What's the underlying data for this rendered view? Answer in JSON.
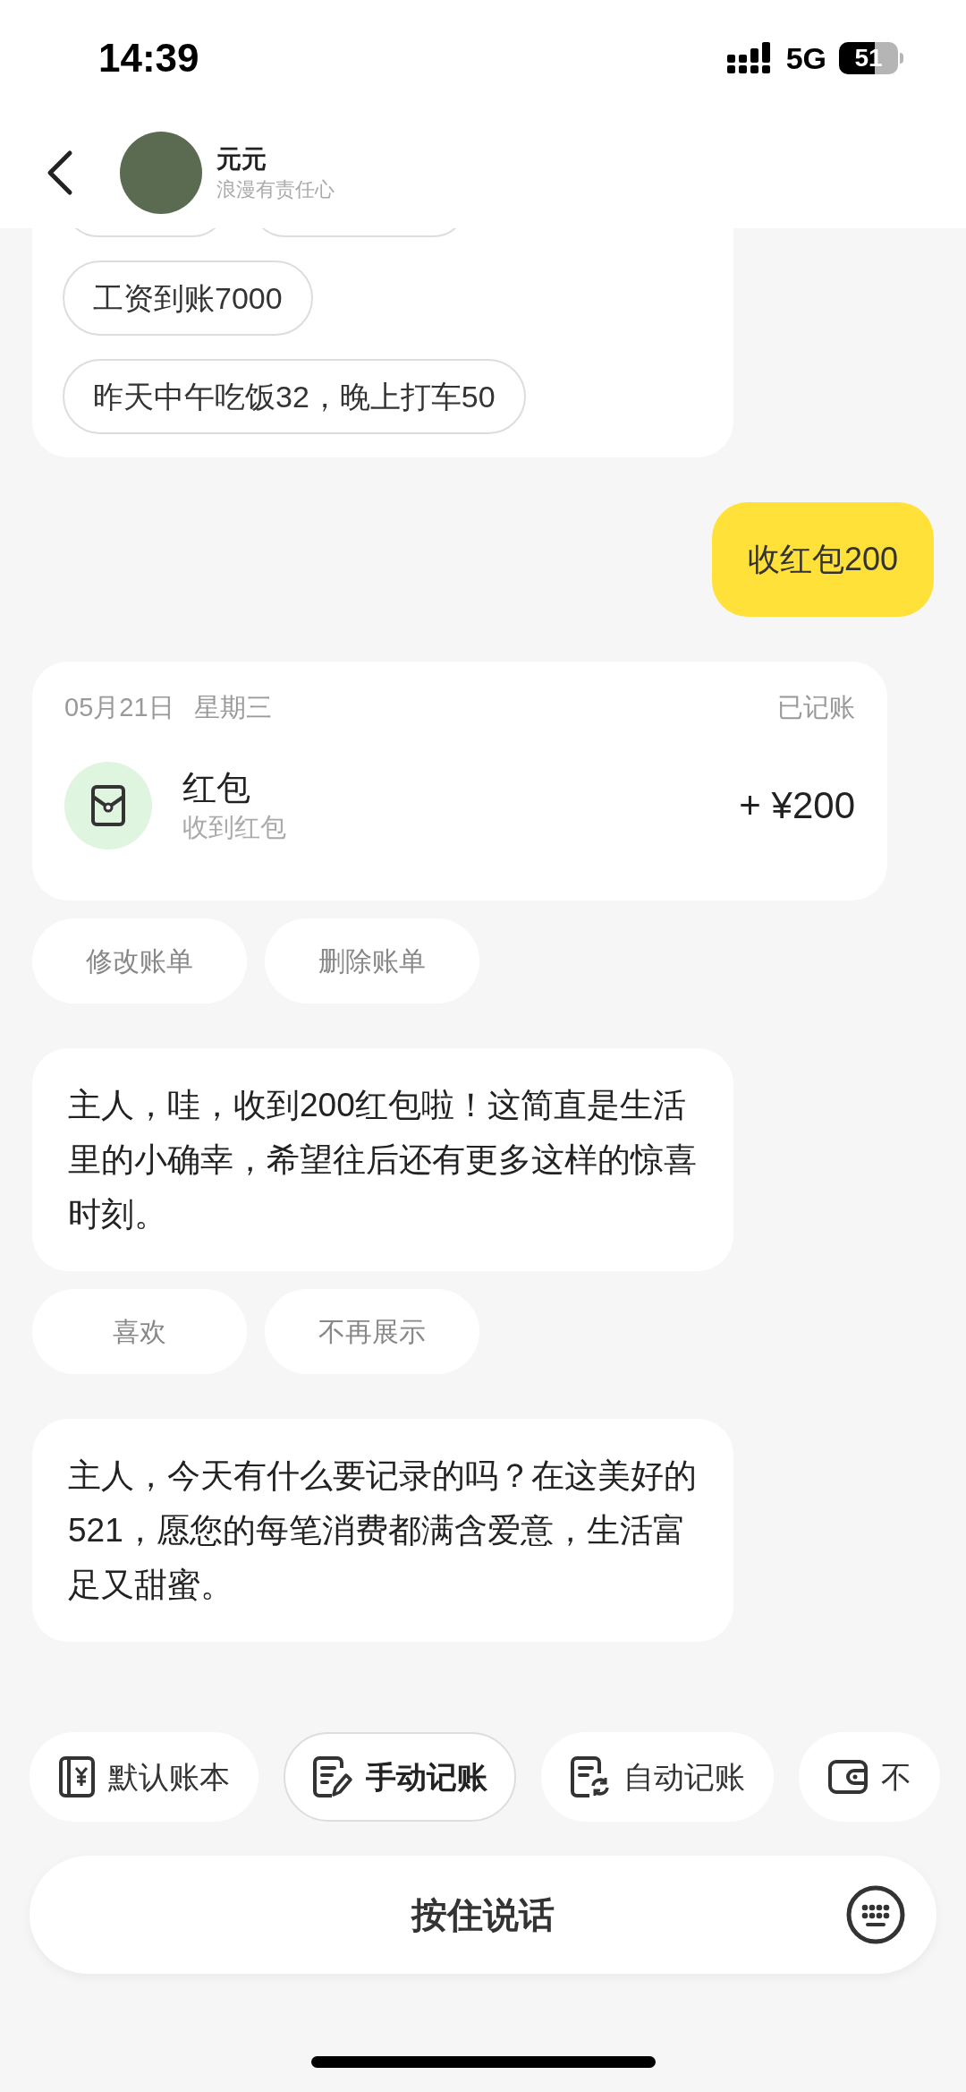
{
  "status_bar": {
    "time": "14:39",
    "network": "5G",
    "battery": "51"
  },
  "header": {
    "name": "元元",
    "subtitle": "浪漫有责任心"
  },
  "messages": [
    {
      "kind": "suggestions",
      "chips": [
        "工资到账7000",
        "昨天中午吃饭32，晚上打车50"
      ]
    },
    {
      "kind": "user",
      "text": "收红包200"
    },
    {
      "kind": "bill",
      "date": "05月21日",
      "weekday": "星期三",
      "status": "已记账",
      "category": "红包",
      "note": "收到红包",
      "amount": "+ ¥200",
      "actions": [
        "修改账单",
        "删除账单"
      ]
    },
    {
      "kind": "bot",
      "text": "主人，哇，收到200红包啦！这简直是生活里的小确幸，希望往后还有更多这样的惊喜时刻。",
      "actions": [
        "喜欢",
        "不再展示"
      ]
    },
    {
      "kind": "bot",
      "text": "主人，今天有什么要记录的吗？在这美好的521，愿您的每笔消费都满含爱意，生活富足又甜蜜。"
    }
  ],
  "toolbar": [
    {
      "kind": "ledger",
      "label": "默认账本",
      "selected": false
    },
    {
      "kind": "manual",
      "label": "手动记账",
      "selected": true
    },
    {
      "kind": "auto",
      "label": "自动记账",
      "selected": false
    },
    {
      "kind": "wallet",
      "label": "不",
      "selected": false
    }
  ],
  "voice_bar": {
    "label": "按住说话"
  }
}
